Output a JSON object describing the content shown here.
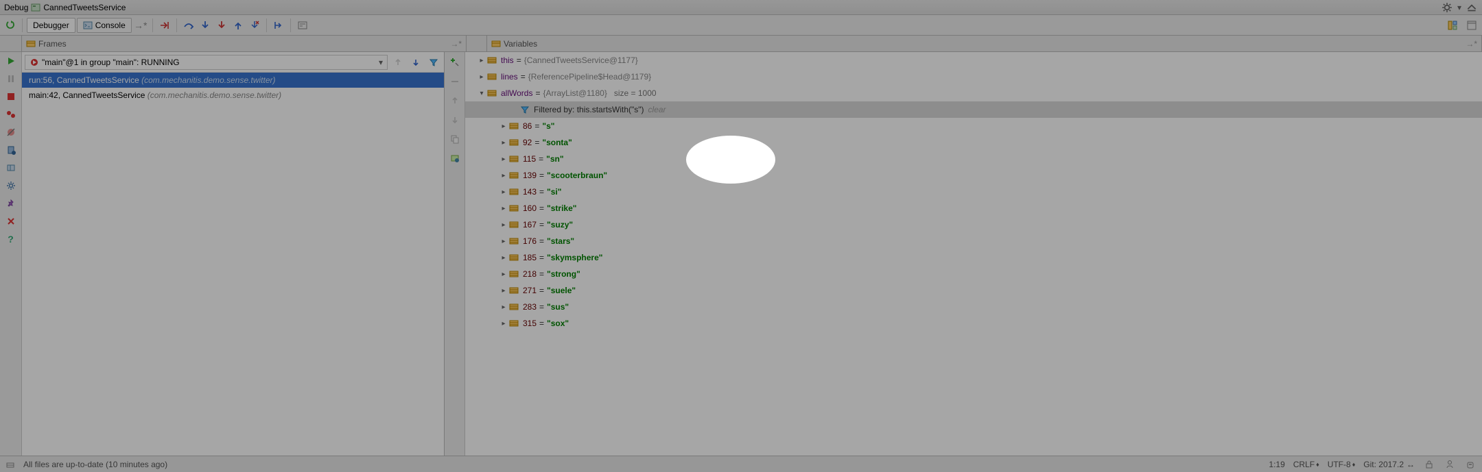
{
  "titlebar": {
    "label": "Debug",
    "tab": "CannedTweetsService"
  },
  "tabs": {
    "debugger": "Debugger",
    "console": "Console"
  },
  "panels": {
    "frames": "Frames",
    "variables": "Variables"
  },
  "thread": {
    "selected": "\"main\"@1 in group \"main\": RUNNING"
  },
  "frames": [
    {
      "loc": "run:56, CannedTweetsService",
      "pkg": "(com.mechanitis.demo.sense.twitter)",
      "selected": true
    },
    {
      "loc": "main:42, CannedTweetsService",
      "pkg": "(com.mechanitis.demo.sense.twitter)",
      "selected": false
    }
  ],
  "vars": {
    "root": [
      {
        "indent": 1,
        "exp": "right",
        "name": "this",
        "val": "{CannedTweetsService@1177}",
        "kind": "obj"
      },
      {
        "indent": 1,
        "exp": "right",
        "name": "lines",
        "val": "{ReferencePipeline$Head@1179}",
        "kind": "obj"
      },
      {
        "indent": 1,
        "exp": "down",
        "name": "allWords",
        "val": "{ArrayList@1180}",
        "size": "size = 1000",
        "kind": "obj"
      }
    ],
    "filter": {
      "label": "Filtered by: this.startsWith(\"s\")",
      "clear": "clear"
    },
    "items": [
      {
        "k": "86",
        "v": "\"s\""
      },
      {
        "k": "92",
        "v": "\"sonta\""
      },
      {
        "k": "115",
        "v": "\"sn\""
      },
      {
        "k": "139",
        "v": "\"scooterbraun\""
      },
      {
        "k": "143",
        "v": "\"si\""
      },
      {
        "k": "160",
        "v": "\"strike\""
      },
      {
        "k": "167",
        "v": "\"suzy\""
      },
      {
        "k": "176",
        "v": "\"stars\""
      },
      {
        "k": "185",
        "v": "\"skymsphere\""
      },
      {
        "k": "218",
        "v": "\"strong\""
      },
      {
        "k": "271",
        "v": "\"suele\""
      },
      {
        "k": "283",
        "v": "\"sus\""
      },
      {
        "k": "315",
        "v": "\"sox\""
      }
    ]
  },
  "status": {
    "msg": "All files are up-to-date (10 minutes ago)",
    "pos": "1:19",
    "lineend": "CRLF",
    "enc": "UTF-8",
    "git": "Git: 2017.2"
  }
}
